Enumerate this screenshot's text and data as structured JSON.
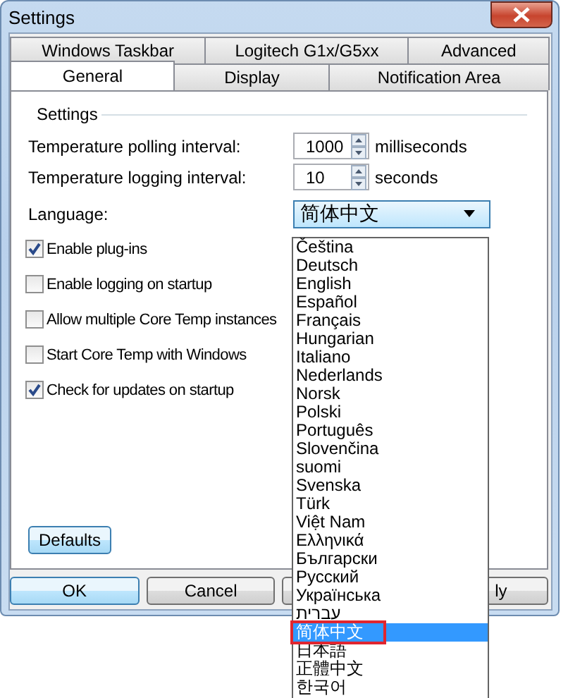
{
  "window": {
    "title": "Settings"
  },
  "tab_rows": [
    [
      {
        "label": "Windows Taskbar",
        "selected": false
      },
      {
        "label": "Logitech G1x/G5xx",
        "selected": false
      },
      {
        "label": "Advanced",
        "selected": false
      }
    ],
    [
      {
        "label": "General",
        "selected": true
      },
      {
        "label": "Display",
        "selected": false
      },
      {
        "label": "Notification Area",
        "selected": false
      }
    ]
  ],
  "group": {
    "title": "Settings"
  },
  "fields": [
    {
      "label": "Temperature polling interval:",
      "value": "1000",
      "unit": "milliseconds"
    },
    {
      "label": "Temperature logging interval:",
      "value": "10",
      "unit": "seconds"
    }
  ],
  "language": {
    "label": "Language:",
    "value": "简体中文",
    "expanded": true,
    "options": [
      {
        "label": "Čeština",
        "selected": false,
        "outlined": false
      },
      {
        "label": "Deutsch",
        "selected": false,
        "outlined": false
      },
      {
        "label": "English",
        "selected": false,
        "outlined": false
      },
      {
        "label": "Español",
        "selected": false,
        "outlined": false
      },
      {
        "label": "Français",
        "selected": false,
        "outlined": false
      },
      {
        "label": "Hungarian",
        "selected": false,
        "outlined": false
      },
      {
        "label": "Italiano",
        "selected": false,
        "outlined": false
      },
      {
        "label": "Nederlands",
        "selected": false,
        "outlined": false
      },
      {
        "label": "Norsk",
        "selected": false,
        "outlined": false
      },
      {
        "label": "Polski",
        "selected": false,
        "outlined": false
      },
      {
        "label": "Português",
        "selected": false,
        "outlined": false
      },
      {
        "label": "Slovenčina",
        "selected": false,
        "outlined": false
      },
      {
        "label": "suomi",
        "selected": false,
        "outlined": false
      },
      {
        "label": "Svenska",
        "selected": false,
        "outlined": false
      },
      {
        "label": "Türk",
        "selected": false,
        "outlined": false
      },
      {
        "label": "Việt Nam",
        "selected": false,
        "outlined": false
      },
      {
        "label": "Ελληνικά",
        "selected": false,
        "outlined": false
      },
      {
        "label": "Български",
        "selected": false,
        "outlined": false
      },
      {
        "label": "Русский",
        "selected": false,
        "outlined": false
      },
      {
        "label": "Українська",
        "selected": false,
        "outlined": false
      },
      {
        "label": "עברית",
        "selected": false,
        "outlined": false
      },
      {
        "label": "简体中文",
        "selected": true,
        "outlined": true
      },
      {
        "label": "日本語",
        "selected": false,
        "outlined": false
      },
      {
        "label": "正體中文",
        "selected": false,
        "outlined": false
      },
      {
        "label": "한국어",
        "selected": false,
        "outlined": false
      }
    ]
  },
  "checkboxes": [
    {
      "label": "Enable plug-ins",
      "checked": true
    },
    {
      "label": "Enable logging on startup",
      "checked": false
    },
    {
      "label": "Allow multiple Core Temp instances",
      "checked": false
    },
    {
      "label": "Start Core Temp with Windows",
      "checked": false
    },
    {
      "label": "Check for updates on startup",
      "checked": true
    }
  ],
  "defaults_button": {
    "label": "Defaults"
  },
  "buttons": [
    {
      "label": "OK",
      "default": true
    },
    {
      "label": "Cancel",
      "default": false
    },
    {
      "default": false
    },
    {
      "label": "ly",
      "default": false
    }
  ]
}
